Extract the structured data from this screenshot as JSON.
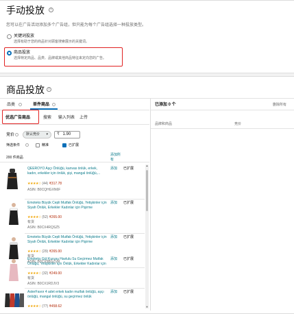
{
  "manual": {
    "title": "手动投放",
    "info_icon": "info-icon",
    "description": "您可以在广告活动添加多个广告组，但只能为每个广告组选择一种投放类型。",
    "option_keyword": {
      "label": "关键词投放",
      "desc": "选择有助于您的商品针对顾客搜索展示的关键词。"
    },
    "option_product": {
      "label": "商品投放",
      "desc": "选择特定商品、品类、品牌或其他商品特征来定向您的广告。"
    }
  },
  "product_targeting": {
    "title": "商品投放",
    "tabs": [
      {
        "label": "品类"
      },
      {
        "label": "单件商品"
      }
    ],
    "subtabs": [
      {
        "label": "优选广告商品"
      },
      {
        "label": "搜索"
      },
      {
        "label": "输入列表"
      },
      {
        "label": "上传"
      }
    ],
    "bid_label": "竞价",
    "bid_select": "默认竞价",
    "bid_value": "1.90",
    "currency": "₹",
    "filter_label": "筛选条件",
    "filter_extended": "精准",
    "filter_broad": "已扩展",
    "count_label": "200 件商品",
    "add_all_link": "添加所有",
    "right_header": "已添加 0 个",
    "remove_all": "删除所有",
    "col_product": "品牌和商品",
    "col_bid": "竞价",
    "products": [
      {
        "title": "QEEROYO Aşçı Önlüğü, kanvas önlük, erkek, kadın, erkekler için önlük, şişi, mangal önlüğü,...",
        "rating_count": "(44)",
        "price": "₹317.78",
        "asin": "ASIN: B0CQHGXN6F",
        "add": "添加",
        "broad": "已扩展"
      },
      {
        "title": "Emoteks Büyük Cepli Mutfak Önlüğü, Yetişkinler için Siyah Önlük, Erkekler Kadınlar için Pişirme",
        "rating_count": "(52)",
        "price": "₹265.00",
        "asin": "ASIN: B0CX4RQSZ5",
        "add": "添加",
        "broad": "已扩展",
        "note": "有货"
      },
      {
        "title": "Emoteks Büyük Cepli Mutfak Önlüğü, Yetişkinler için Siyah Önlük, Erkekler Kadınlar için Pişirme",
        "rating_count": "(29)",
        "price": "₹265.00",
        "asin": "ASIN: B0CX5BGZVR",
        "add": "添加",
        "broad": "已扩展",
        "note": "有货"
      },
      {
        "title": "Emoteks Gül Kurusu Havlulu Su Geçirmez Mutfak Önlüğü, Yetişkinler için Önlük, Erkekler Kadınlar için",
        "rating_count": "(32)",
        "price": "₹249.00",
        "asin": "ASIN: B0CX1RDJV3",
        "add": "添加",
        "broad": "已扩展",
        "note": "有货"
      },
      {
        "title": "AsterFavor 4 adet erkek kadın mutfak önlüğü, aşçı önlüğü, mangal önlüğü, su geçirmez önlük",
        "rating_count": "(77)",
        "price": "₹458.62",
        "asin": "",
        "add": "添加",
        "broad": "已扩展"
      }
    ]
  }
}
